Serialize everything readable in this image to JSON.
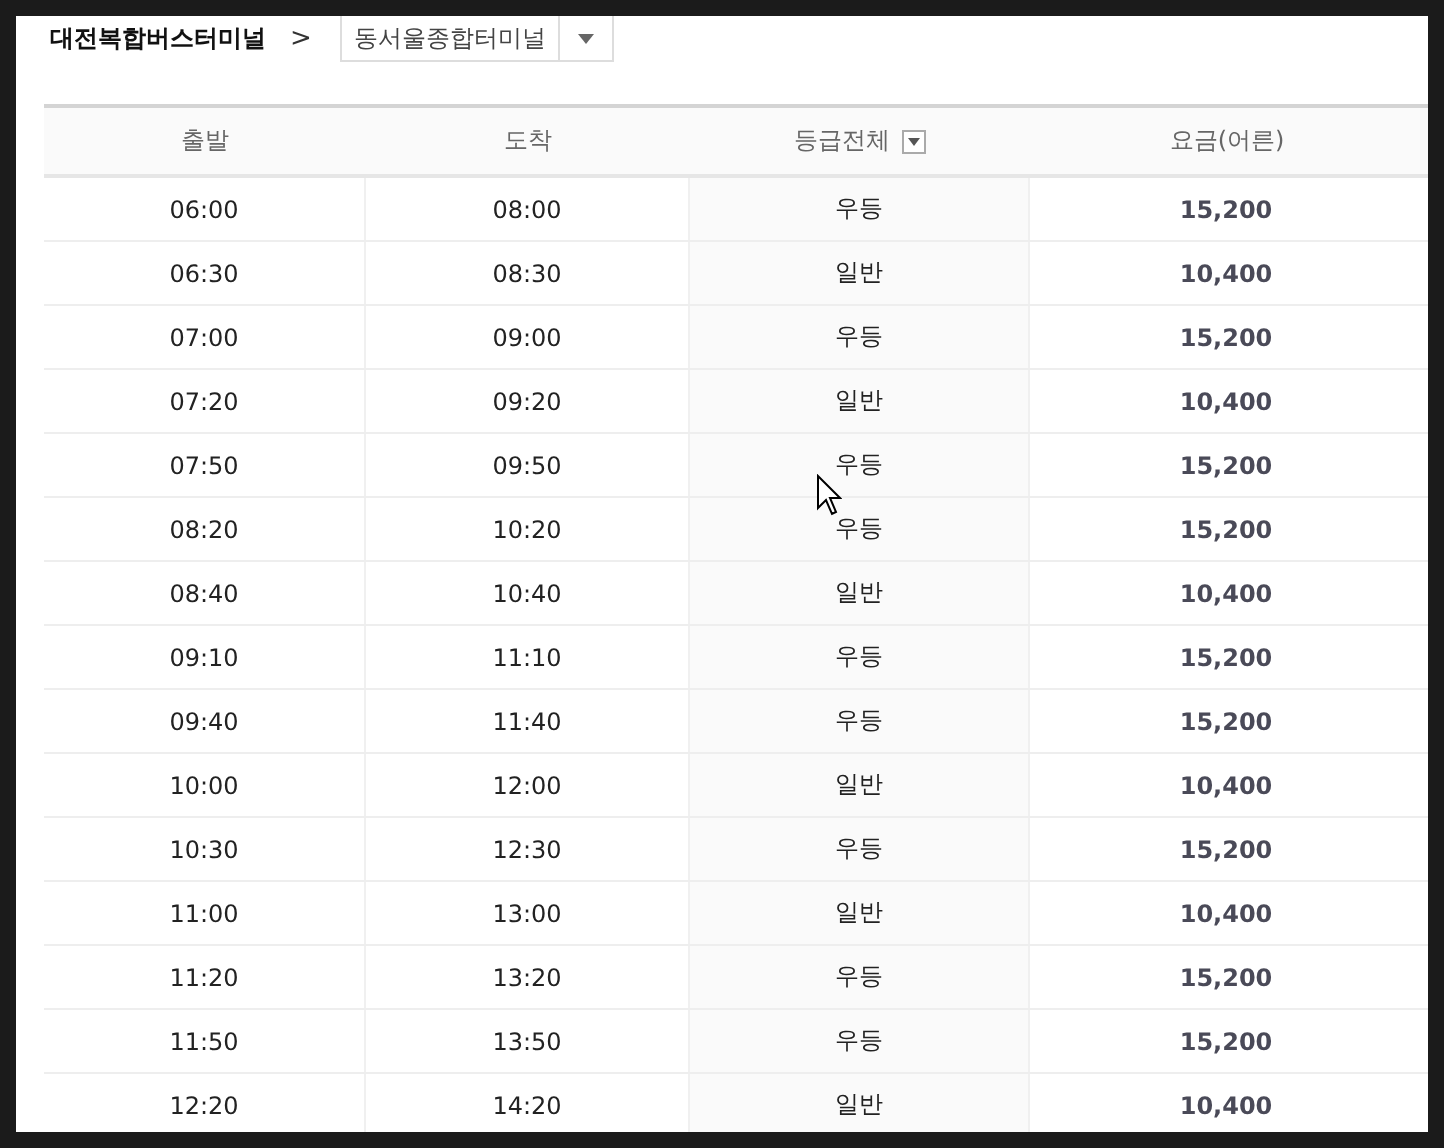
{
  "route": {
    "origin": "대전복합버스터미널",
    "separator": ">",
    "destination": "동서울종합터미널"
  },
  "table": {
    "columns": [
      {
        "label": "출발",
        "kind": "plain"
      },
      {
        "label": "도착",
        "kind": "plain"
      },
      {
        "label": "등급전체",
        "kind": "filter"
      },
      {
        "label": "요금(어른)",
        "kind": "plain"
      }
    ],
    "rows": [
      {
        "departure": "06:00",
        "arrival": "08:00",
        "grade": "우등",
        "fare": "15,200"
      },
      {
        "departure": "06:30",
        "arrival": "08:30",
        "grade": "일반",
        "fare": "10,400"
      },
      {
        "departure": "07:00",
        "arrival": "09:00",
        "grade": "우등",
        "fare": "15,200"
      },
      {
        "departure": "07:20",
        "arrival": "09:20",
        "grade": "일반",
        "fare": "10,400"
      },
      {
        "departure": "07:50",
        "arrival": "09:50",
        "grade": "우등",
        "fare": "15,200"
      },
      {
        "departure": "08:20",
        "arrival": "10:20",
        "grade": "우등",
        "fare": "15,200"
      },
      {
        "departure": "08:40",
        "arrival": "10:40",
        "grade": "일반",
        "fare": "10,400"
      },
      {
        "departure": "09:10",
        "arrival": "11:10",
        "grade": "우등",
        "fare": "15,200"
      },
      {
        "departure": "09:40",
        "arrival": "11:40",
        "grade": "우등",
        "fare": "15,200"
      },
      {
        "departure": "10:00",
        "arrival": "12:00",
        "grade": "일반",
        "fare": "10,400"
      },
      {
        "departure": "10:30",
        "arrival": "12:30",
        "grade": "우등",
        "fare": "15,200"
      },
      {
        "departure": "11:00",
        "arrival": "13:00",
        "grade": "일반",
        "fare": "10,400"
      },
      {
        "departure": "11:20",
        "arrival": "13:20",
        "grade": "우등",
        "fare": "15,200"
      },
      {
        "departure": "11:50",
        "arrival": "13:50",
        "grade": "우등",
        "fare": "15,200"
      },
      {
        "departure": "12:20",
        "arrival": "14:20",
        "grade": "일반",
        "fare": "10,400"
      }
    ]
  }
}
